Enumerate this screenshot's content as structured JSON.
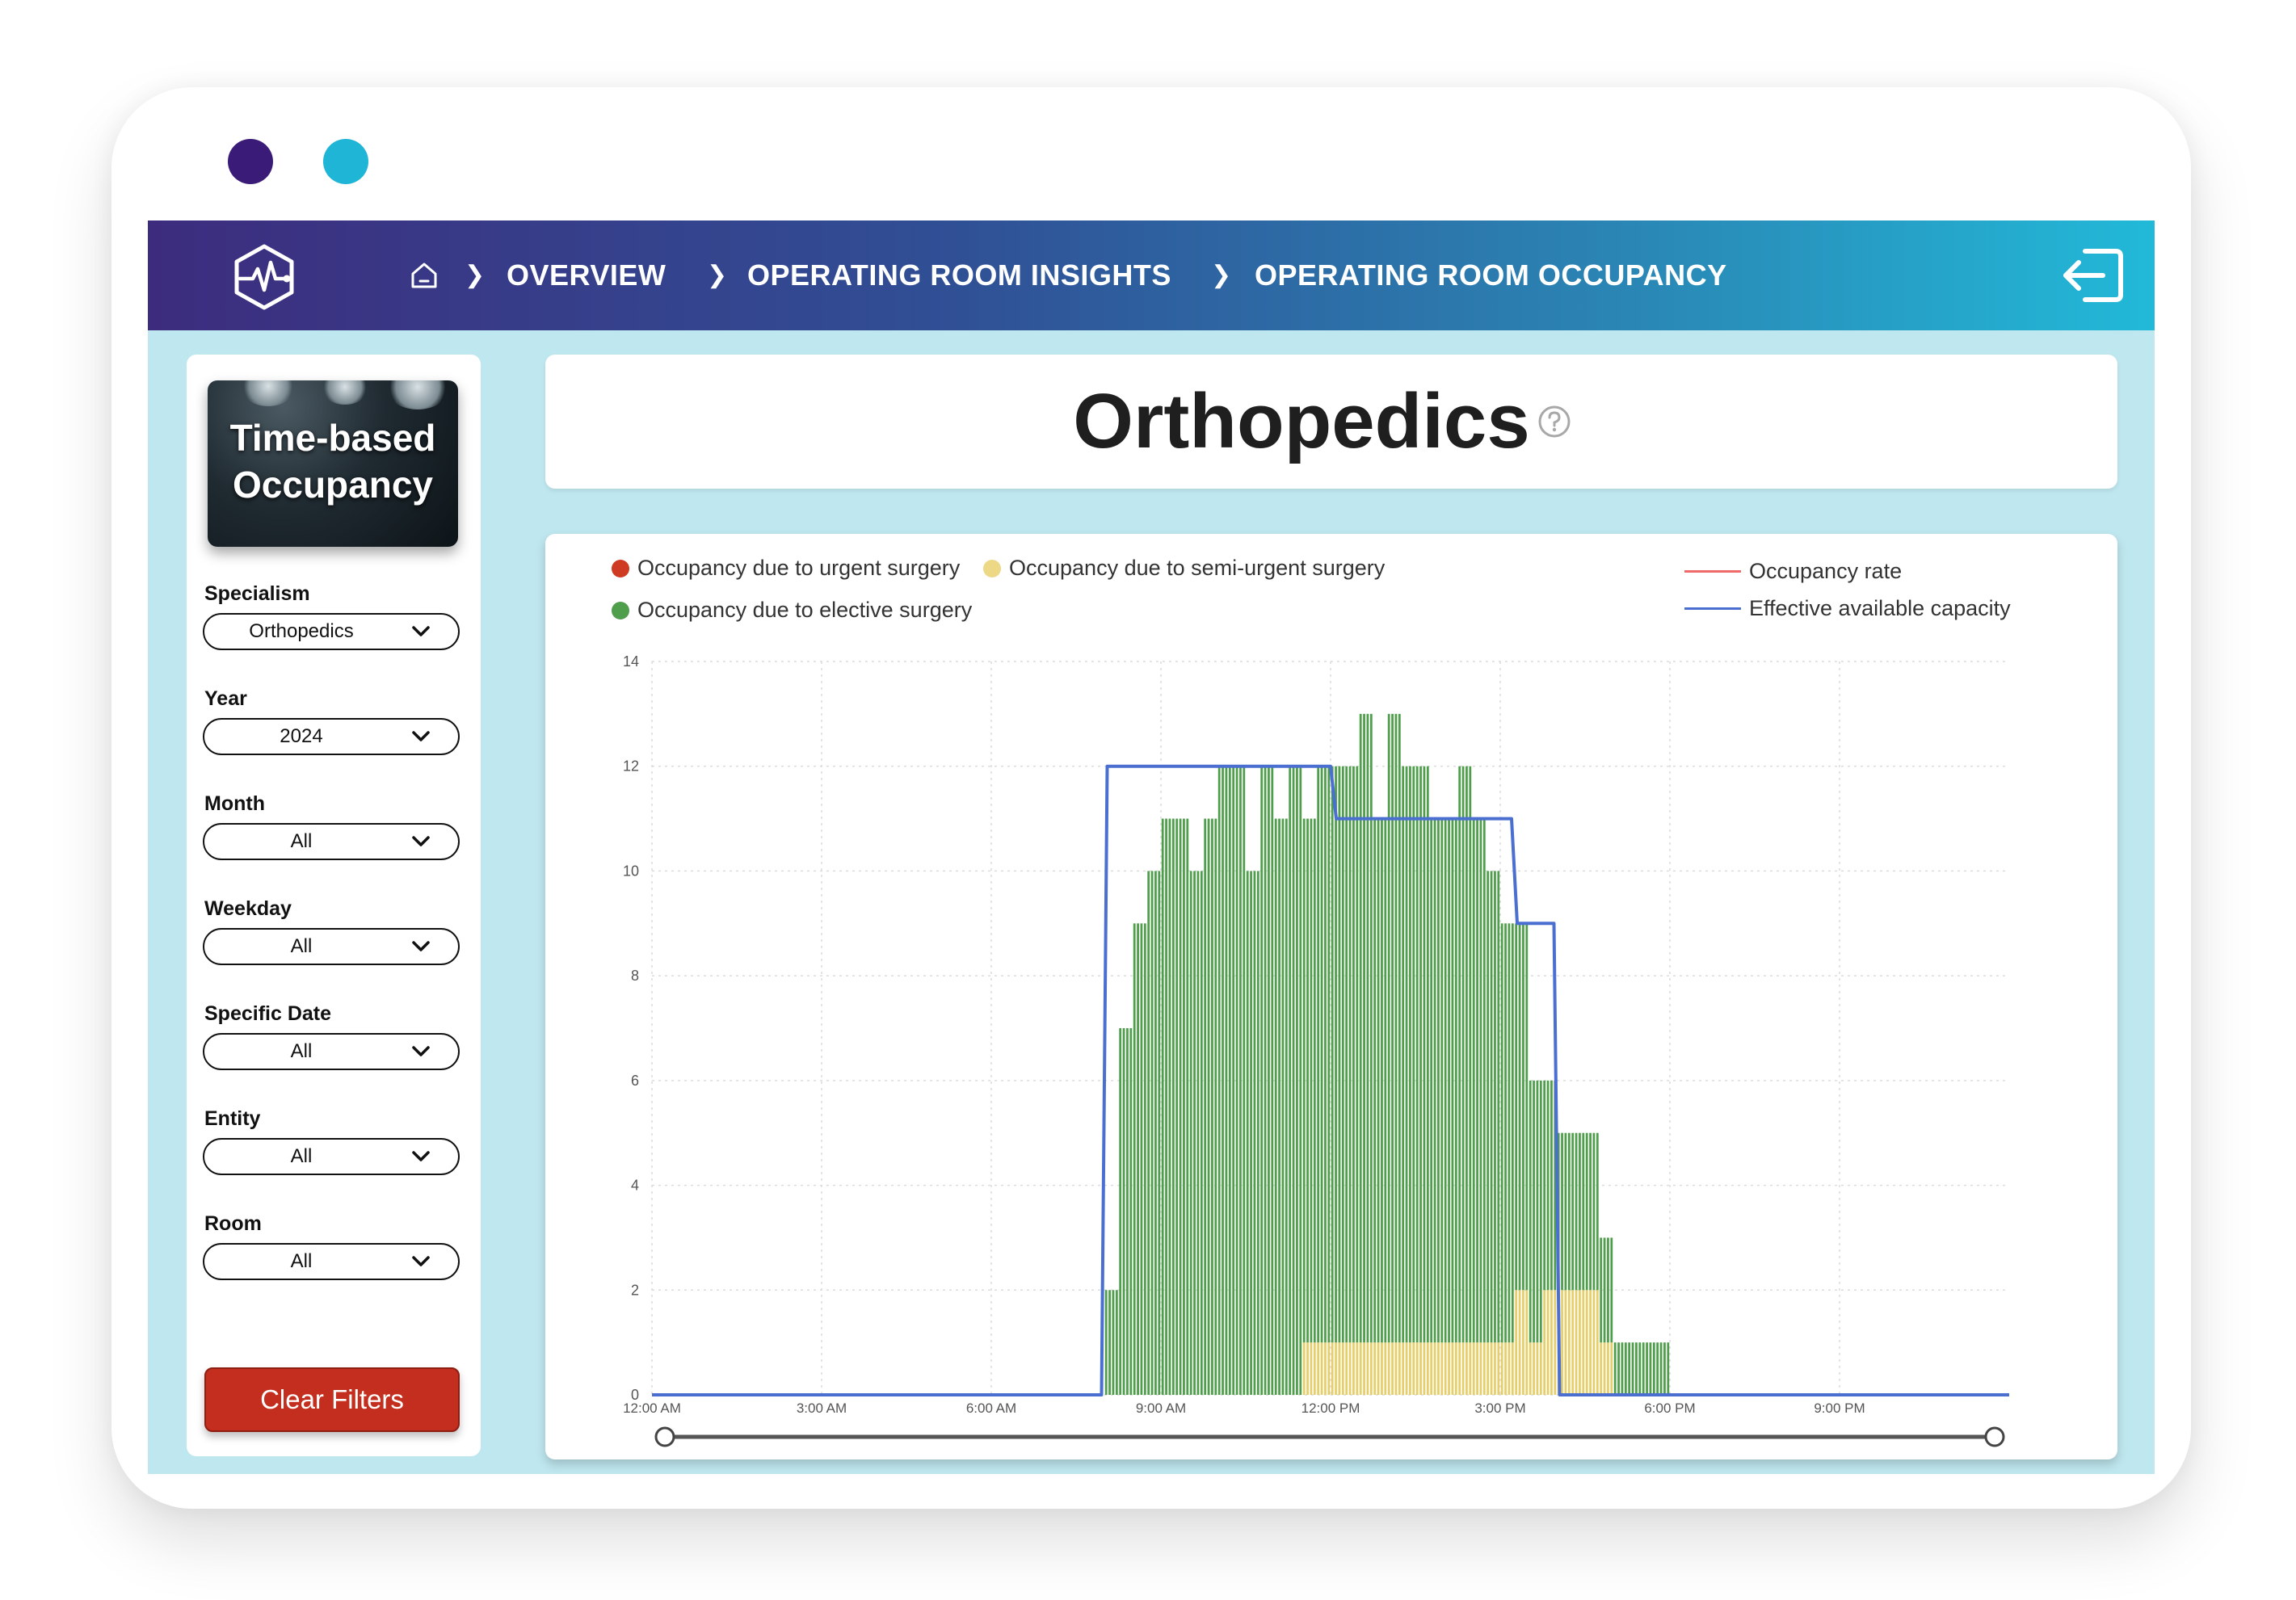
{
  "window": {
    "dot_colors": [
      "#3b1b78",
      "#1eb5d6"
    ]
  },
  "header": {
    "breadcrumbs": [
      {
        "label": "OVERVIEW"
      },
      {
        "label": "OPERATING ROOM INSIGHTS"
      },
      {
        "label": "OPERATING ROOM OCCUPANCY"
      }
    ],
    "icons": {
      "logo": "heartbeat-hexagon-icon",
      "home": "home-icon",
      "logout": "logout-icon"
    }
  },
  "sidebar": {
    "hero_title_line1": "Time-based",
    "hero_title_line2": "Occupancy",
    "filters": [
      {
        "label": "Specialism",
        "value": "Orthopedics"
      },
      {
        "label": "Year",
        "value": "2024"
      },
      {
        "label": "Month",
        "value": "All"
      },
      {
        "label": "Weekday",
        "value": "All"
      },
      {
        "label": "Specific Date",
        "value": "All"
      },
      {
        "label": "Entity",
        "value": "All"
      },
      {
        "label": "Room",
        "value": "All"
      }
    ],
    "clear_label": "Clear Filters"
  },
  "main": {
    "title": "Orthopedics"
  },
  "colors": {
    "urgent": "#cf3a22",
    "semi_urgent": "#ecd885",
    "elective": "#4f9e4c",
    "occupancy_rate": "#f06a6a",
    "capacity": "#4a6fd0",
    "accent_red": "#c42e1e"
  },
  "chart_data": {
    "type": "bar",
    "legend": [
      {
        "name": "Occupancy due to urgent surgery",
        "kind": "dot",
        "color": "#cf3a22"
      },
      {
        "name": "Occupancy due to semi-urgent surgery",
        "kind": "dot",
        "color": "#ecd885"
      },
      {
        "name": "Occupancy due to elective surgery",
        "kind": "dot",
        "color": "#4f9e4c"
      },
      {
        "name": "Occupancy rate",
        "kind": "line",
        "color": "#f06a6a"
      },
      {
        "name": "Effective available capacity",
        "kind": "line",
        "color": "#4a6fd0"
      }
    ],
    "x_unit": "hours",
    "xlim": [
      0,
      24
    ],
    "ylim": [
      0,
      14
    ],
    "y_ticks": [
      0,
      2,
      4,
      6,
      8,
      10,
      12,
      14
    ],
    "x_ticks": [
      {
        "value": 0,
        "label": "12:00 AM"
      },
      {
        "value": 3,
        "label": "3:00 AM"
      },
      {
        "value": 6,
        "label": "6:00 AM"
      },
      {
        "value": 9,
        "label": "9:00 AM"
      },
      {
        "value": 12,
        "label": "12:00 PM"
      },
      {
        "value": 15,
        "label": "3:00 PM"
      },
      {
        "value": 18,
        "label": "6:00 PM"
      },
      {
        "value": 21,
        "label": "9:00 PM"
      }
    ],
    "grid": true,
    "bar_interval_hours": 0.25,
    "bars_start_hour": 8,
    "elective": [
      2,
      7,
      9,
      10,
      11,
      11,
      10,
      11,
      12,
      12,
      10,
      12,
      11,
      12,
      10,
      11,
      11,
      11,
      12,
      10,
      12,
      11,
      11,
      10,
      10,
      11,
      10,
      9,
      8,
      7,
      5,
      4,
      3,
      3,
      3,
      2,
      1,
      1,
      1,
      1
    ],
    "semi_urgent": [
      0,
      0,
      0,
      0,
      0,
      0,
      0,
      0,
      0,
      0,
      0,
      0,
      0,
      0,
      1,
      1,
      1,
      1,
      1,
      1,
      1,
      1,
      1,
      1,
      1,
      1,
      1,
      1,
      1,
      2,
      1,
      2,
      2,
      2,
      2,
      1,
      0,
      0,
      0,
      0
    ],
    "capacity": [
      [
        0,
        0
      ],
      [
        7.95,
        0
      ],
      [
        8.05,
        12
      ],
      [
        12.0,
        12
      ],
      [
        12.1,
        11
      ],
      [
        15.2,
        11
      ],
      [
        15.3,
        9
      ],
      [
        15.95,
        9
      ],
      [
        16.05,
        0
      ],
      [
        24,
        0
      ]
    ],
    "occupancy_rate": [],
    "range_slider": {
      "start_hour": 0,
      "end_hour": 24
    }
  }
}
